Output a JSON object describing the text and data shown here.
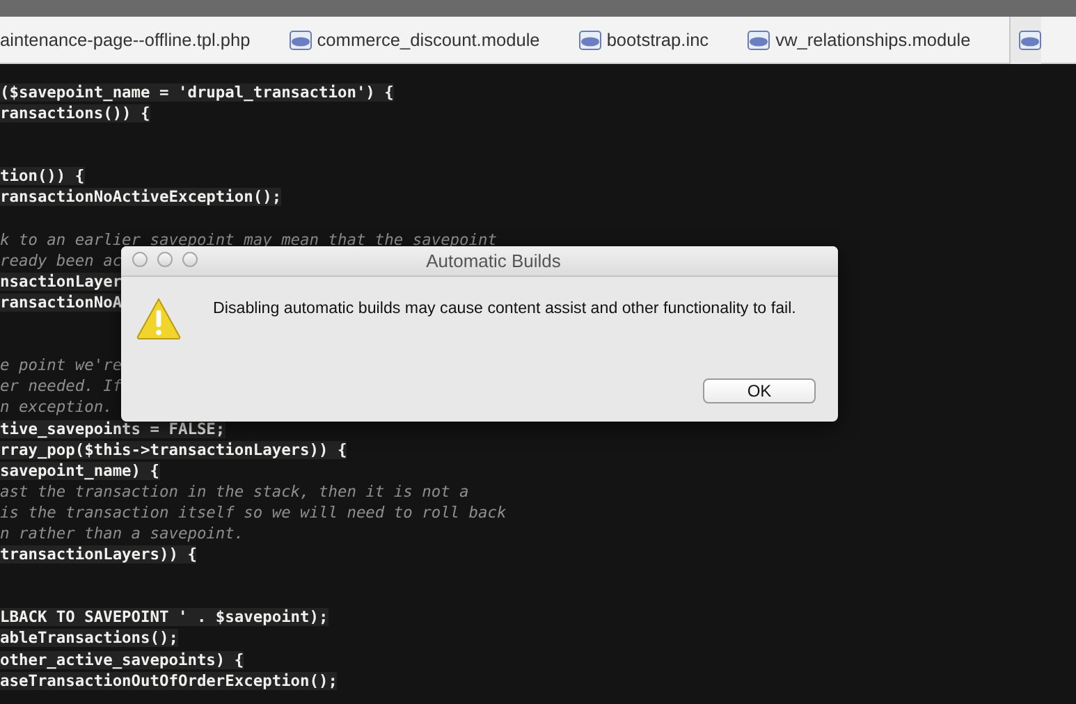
{
  "tabs": [
    {
      "label": "aintenance-page--offline.tpl.php",
      "icon": false
    },
    {
      "label": "commerce_discount.module",
      "icon": true
    },
    {
      "label": "bootstrap.inc",
      "icon": true
    },
    {
      "label": "vw_relationships.module",
      "icon": true
    },
    {
      "icon": true
    }
  ],
  "code_lines": [
    {
      "kind": "code",
      "text": "($savepoint_name = 'drupal_transaction') {"
    },
    {
      "kind": "code",
      "text": "ransactions()) {"
    },
    {
      "kind": "blank"
    },
    {
      "kind": "blank"
    },
    {
      "kind": "code",
      "text": "tion()) {"
    },
    {
      "kind": "code",
      "text": "ransactionNoActiveException();"
    },
    {
      "kind": "blank"
    },
    {
      "kind": "comment",
      "text": "k to an earlier savepoint may mean that the savepoint"
    },
    {
      "kind": "comment",
      "text": "ready been ac"
    },
    {
      "kind": "code",
      "text": "nsactionLayer"
    },
    {
      "kind": "code",
      "text": "ransactionNoA"
    },
    {
      "kind": "blank"
    },
    {
      "kind": "blank"
    },
    {
      "kind": "comment",
      "text": "e point we're"
    },
    {
      "kind": "comment",
      "text": "er needed. If"
    },
    {
      "kind": "comment",
      "text": "n exception."
    },
    {
      "kind": "code",
      "text": "tive_savepoints = FALSE;"
    },
    {
      "kind": "code",
      "text": "rray_pop($this->transactionLayers)) {"
    },
    {
      "kind": "code",
      "text": "savepoint_name) {"
    },
    {
      "kind": "comment",
      "text": "ast the transaction in the stack, then it is not a"
    },
    {
      "kind": "comment",
      "text": "is the transaction itself so we will need to roll back"
    },
    {
      "kind": "comment",
      "text": "n rather than a savepoint."
    },
    {
      "kind": "code",
      "text": "transactionLayers)) {"
    },
    {
      "kind": "blank"
    },
    {
      "kind": "blank"
    },
    {
      "kind": "code",
      "text": "LBACK TO SAVEPOINT ' . $savepoint);"
    },
    {
      "kind": "code",
      "text": "ableTransactions();"
    },
    {
      "kind": "code",
      "text": "other_active_savepoints) {"
    },
    {
      "kind": "code",
      "text": "aseTransactionOutOfOrderException();"
    }
  ],
  "dialog": {
    "title": "Automatic Builds",
    "message": "Disabling automatic builds may cause content assist and other functionality to fail.",
    "buttons": [
      "OK"
    ]
  }
}
